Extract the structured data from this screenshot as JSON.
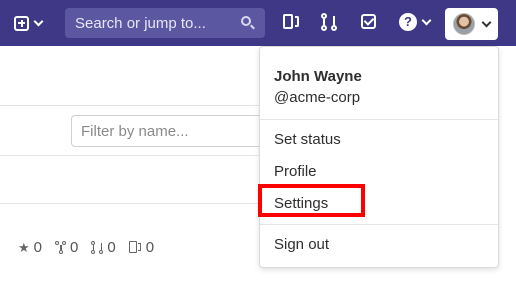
{
  "navbar": {
    "search_placeholder": "Search or jump to...",
    "icons": [
      "plus-square-icon",
      "chevron-down-icon",
      "search-icon",
      "issues-icon",
      "merge-request-icon",
      "todo-check-icon",
      "help-icon",
      "avatar"
    ],
    "help_glyph": "?"
  },
  "page": {
    "filter_placeholder": "Filter by name...",
    "stats": [
      {
        "icon": "star-icon",
        "value": "0"
      },
      {
        "icon": "fork-icon",
        "value": "0"
      },
      {
        "icon": "merge-request-icon",
        "value": "0"
      },
      {
        "icon": "issues-icon",
        "value": "0"
      }
    ]
  },
  "user_menu": {
    "name": "John Wayne",
    "handle": "@acme-corp",
    "items": [
      {
        "label": "Set status"
      },
      {
        "label": "Profile"
      },
      {
        "label": "Settings",
        "highlighted": true
      },
      {
        "label": "Sign out"
      }
    ]
  },
  "colors": {
    "navbar": "#3e3886",
    "search_bg": "#5c57a1",
    "highlight": "#ff0000"
  }
}
